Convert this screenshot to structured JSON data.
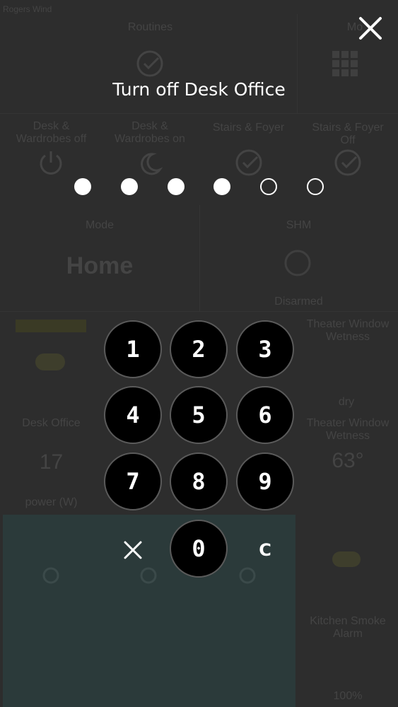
{
  "dialog": {
    "title": "Turn off Desk Office",
    "pin_length": 6,
    "pin_entered": 4,
    "clear_label": "C"
  },
  "keypad": {
    "keys": [
      "1",
      "2",
      "3",
      "4",
      "5",
      "6",
      "7",
      "8",
      "9",
      "0"
    ]
  },
  "icons": {
    "close": "close-icon",
    "cancel": "x-icon"
  },
  "background": {
    "status_bar": "Rogers Wind",
    "tiles": {
      "routines": "Routines",
      "modes": "Mo",
      "desk_wardrobes_off": "Desk &\nWardrobes off",
      "desk_wardrobes_on": "Desk &\nWardrobes on",
      "stairs_foyer": "Stairs & Foyer",
      "stairs_foyer_off": "Stairs & Foyer\nOff",
      "mode_label": "Mode",
      "mode_value": "Home",
      "shm_label": "SHM",
      "shm_value": "Disarmed",
      "theater_window_wetness": "Theater Window\nWetness",
      "dry": "dry",
      "desk_office": "Desk Office",
      "desk_office_value": "17",
      "power_w": "power (W)",
      "theater_window_wetness_2": "Theater Window\nWetness",
      "temp_value": "63°",
      "kitchen_smoke_alarm": "Kitchen Smoke\nAlarm",
      "pct": "100%"
    }
  },
  "colors": {
    "overlay": "#2d2d2d",
    "key_bg": "#000000",
    "key_border": "#5a5a5a",
    "text": "#ffffff",
    "faded_text": "#444444",
    "faded_weather": "#2b3a3a",
    "faded_accent": "#3a3a25"
  }
}
